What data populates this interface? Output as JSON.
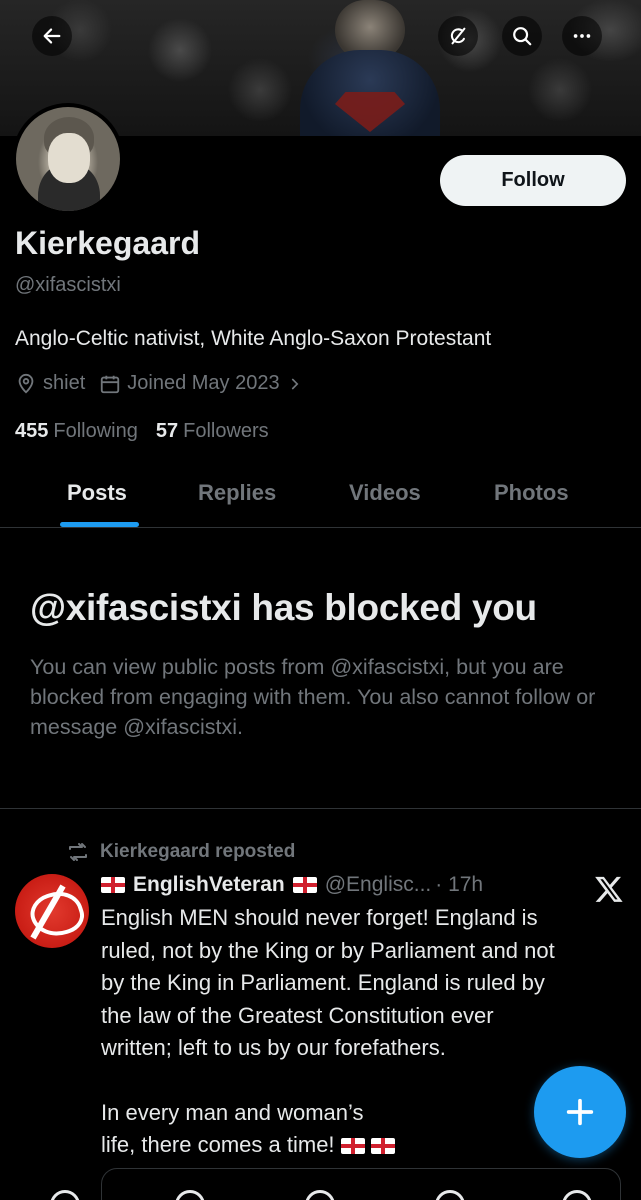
{
  "header": {
    "back_icon": "arrow-left-icon",
    "grok_icon": "grok-icon",
    "search_icon": "search-icon",
    "more_icon": "more-horizontal-icon"
  },
  "profile": {
    "follow_label": "Follow",
    "display_name": "Kierkegaard",
    "handle": "@xifascistxi",
    "bio": "Anglo-Celtic nativist, White Anglo-Saxon Protestant",
    "location": "shiet",
    "joined": "Joined May 2023",
    "following_count": "455",
    "following_label": "Following",
    "followers_count": "57",
    "followers_label": "Followers"
  },
  "tabs": [
    "Posts",
    "Replies",
    "Videos",
    "Photos"
  ],
  "blocked": {
    "title": "@xifascistxi has blocked you",
    "description": "You can view public posts from @xifascistxi, but you are blocked from engaging with them. You also cannot follow or message @xifascistxi."
  },
  "post": {
    "repost_label": "Kierkegaard reposted",
    "author_name": "EnglishVeteran",
    "author_handle": "@Englisc...",
    "time": "· 17h",
    "lines": [
      "English MEN should never forget! England is",
      "ruled, not by the King or by Parliament and not",
      "by the King in Parliament. England is ruled by",
      "the law of the Greatest Constitution ever",
      "written; left to us by our forefathers."
    ],
    "lines2": [
      "In every man and woman’s",
      "life, there comes a time!"
    ]
  },
  "colors": {
    "background": "#000000",
    "accent": "#1d9bf0",
    "text_primary": "#e7e9ea",
    "text_secondary": "#71767b",
    "border": "#2f3336"
  }
}
